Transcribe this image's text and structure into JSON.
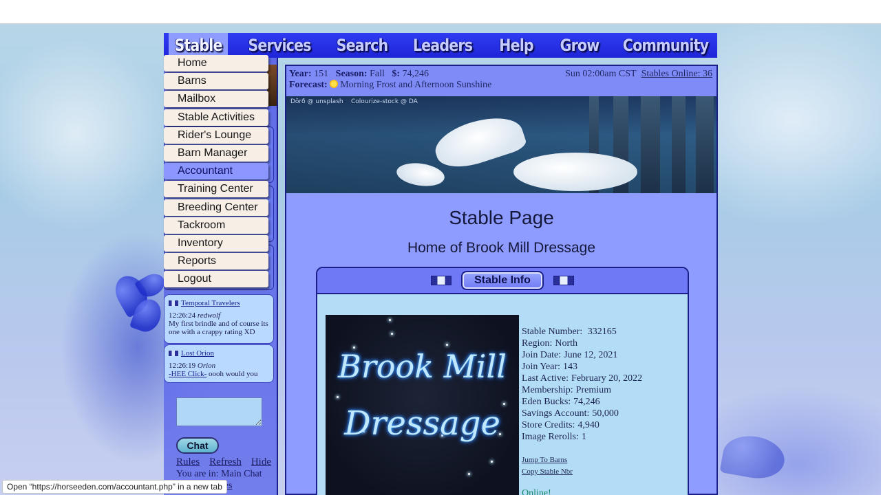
{
  "nav": [
    "Stable",
    "Services",
    "Search",
    "Leaders",
    "Help",
    "Grow",
    "Community"
  ],
  "menu": [
    "Home",
    "Barns",
    "Mailbox",
    "Stable Activities",
    "Rider's Lounge",
    "Barn Manager",
    "Accountant",
    "Training Center",
    "Breeding Center",
    "Tackroom",
    "Inventory",
    "Reports",
    "Logout"
  ],
  "chat": [
    {
      "room": "Temporal Travelers",
      "time": "12:26:24",
      "user": "redwolf",
      "text": "My first brindle and of course its one with a crappy rating XD"
    },
    {
      "room": "Lost Orion",
      "time": "12:26:19",
      "user": "Orion",
      "link": "-HEE Click-",
      "text": " oooh would you"
    }
  ],
  "chat_controls": {
    "button": "Chat",
    "links": [
      "Rules",
      "Refresh",
      "Hide"
    ],
    "where": "You are in: Main Chat",
    "extra": "iles"
  },
  "info": {
    "year_label": "Year:",
    "year": "151",
    "season_label": "Season:",
    "season": "Fall",
    "money_label": "$:",
    "money": "74,246",
    "time": "Sun 02:00am CST",
    "online": "Stables Online: 36",
    "forecast_label": "Forecast:",
    "forecast": "Morning Frost and Afternoon Sunshine"
  },
  "banner_credits": [
    "Dörð @ unsplash",
    "Colourize-stock @ DA"
  ],
  "page_title": "Stable Page",
  "page_subtitle": "Home of Brook Mill Dressage",
  "card": {
    "tab": "Stable Info",
    "logo_line1": "Brook Mill",
    "logo_line2": "Dressage",
    "stats": [
      {
        "label": "Stable Number:",
        "value": " 332165"
      },
      {
        "label": "Region:",
        "value": "North"
      },
      {
        "label": "Join Date:",
        "value": "June 12, 2021"
      },
      {
        "label": "Join Year:",
        "value": "143"
      },
      {
        "label": "Last Active:",
        "value": "February 20, 2022"
      },
      {
        "label": "Membership:",
        "value": "Premium"
      },
      {
        "label": "Eden Bucks:",
        "value": "74,246"
      },
      {
        "label": "Savings Account:",
        "value": "50,000"
      },
      {
        "label": "Store Credits:",
        "value": "4,940"
      },
      {
        "label": "Image Rerolls:",
        "value": "1"
      }
    ],
    "links": [
      "Jump To Barns",
      "Copy Stable Nbr"
    ],
    "online": "Online!"
  },
  "status_bar": "Open “https://horseeden.com/accountant.php” in a new tab"
}
